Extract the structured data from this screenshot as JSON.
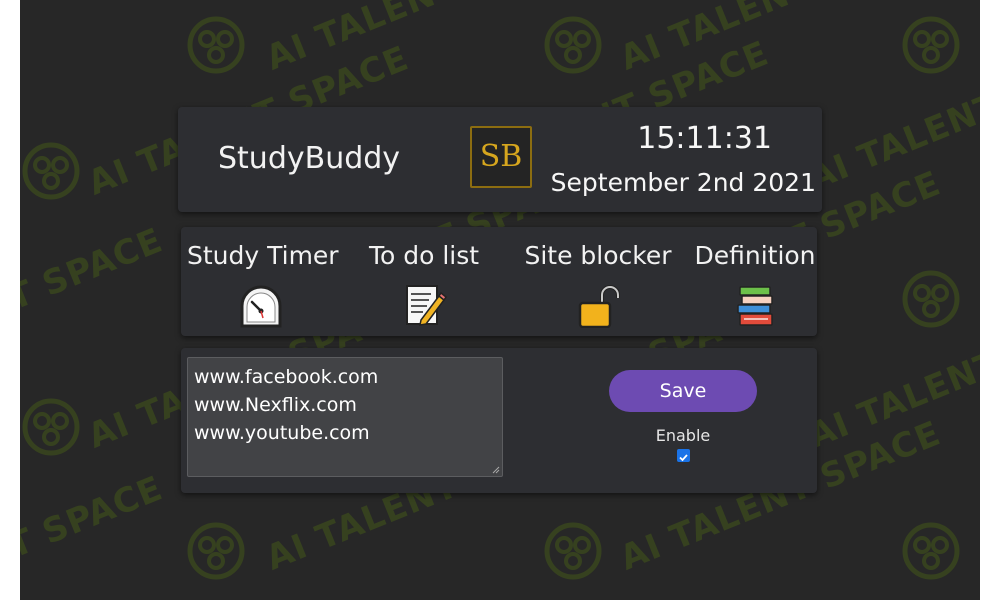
{
  "watermark": {
    "text": "AI TALENT SPACE",
    "short_left": "T SPACE",
    "color": "#3b4a1d"
  },
  "header": {
    "app_title": "StudyBuddy",
    "logo_text": "SB",
    "time": "15:11:31",
    "date": "September 2nd 2021"
  },
  "nav": {
    "items": [
      {
        "label": "Study Timer",
        "icon": "stopwatch-icon"
      },
      {
        "label": "To do list",
        "icon": "memo-icon"
      },
      {
        "label": "Site blocker",
        "icon": "padlock-icon"
      },
      {
        "label": "Definition",
        "icon": "books-icon"
      }
    ]
  },
  "blocker": {
    "sites": [
      "www.facebook.com",
      "www.Nexflix.com",
      "www.youtube.com"
    ],
    "save_label": "Save",
    "enable_label": "Enable",
    "enabled": true
  },
  "colors": {
    "background": "#272727",
    "panel": "#2d2e32",
    "accent": "#6d4bb2",
    "logo_gold": "#d6a61e"
  }
}
